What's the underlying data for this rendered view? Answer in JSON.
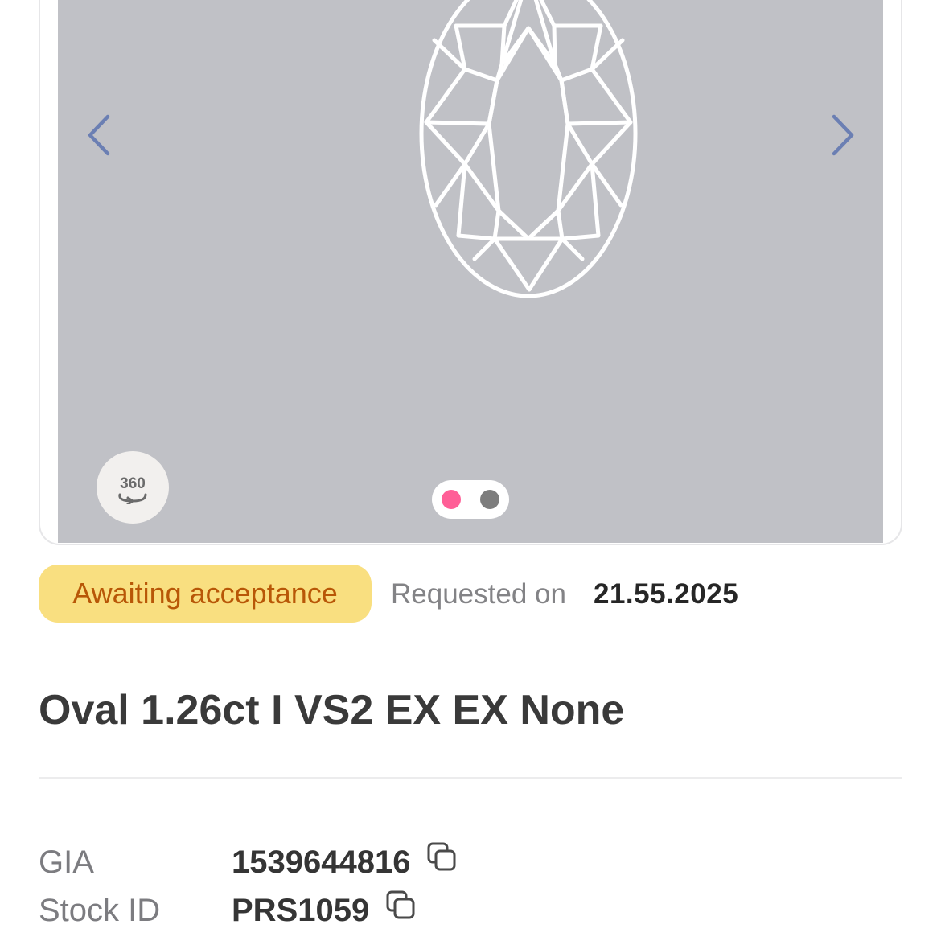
{
  "carousel": {
    "prev_icon": "chevron-left-icon",
    "next_icon": "chevron-right-icon",
    "rotate_label": "360",
    "rotate_icon": "rotate-360-icon",
    "slides_total": 2,
    "active_slide": 1,
    "colors": {
      "media_background": "#c0c1c6",
      "arrow": "#6b7fb3",
      "dot_active": "#ff5f97",
      "dot_inactive": "#7d7d7d"
    }
  },
  "status": {
    "badge": "Awaiting acceptance",
    "requested_label": "Requested on",
    "requested_date": "21.55.2025",
    "colors": {
      "badge_background": "#f9df80",
      "badge_text": "#b85707"
    }
  },
  "product": {
    "title": "Oval 1.26ct I VS2 EX EX None"
  },
  "details": [
    {
      "label": "GIA",
      "value": "1539644816",
      "icon": "copy-icon"
    },
    {
      "label": "Stock ID",
      "value": "PRS1059",
      "icon": "copy-icon"
    }
  ]
}
